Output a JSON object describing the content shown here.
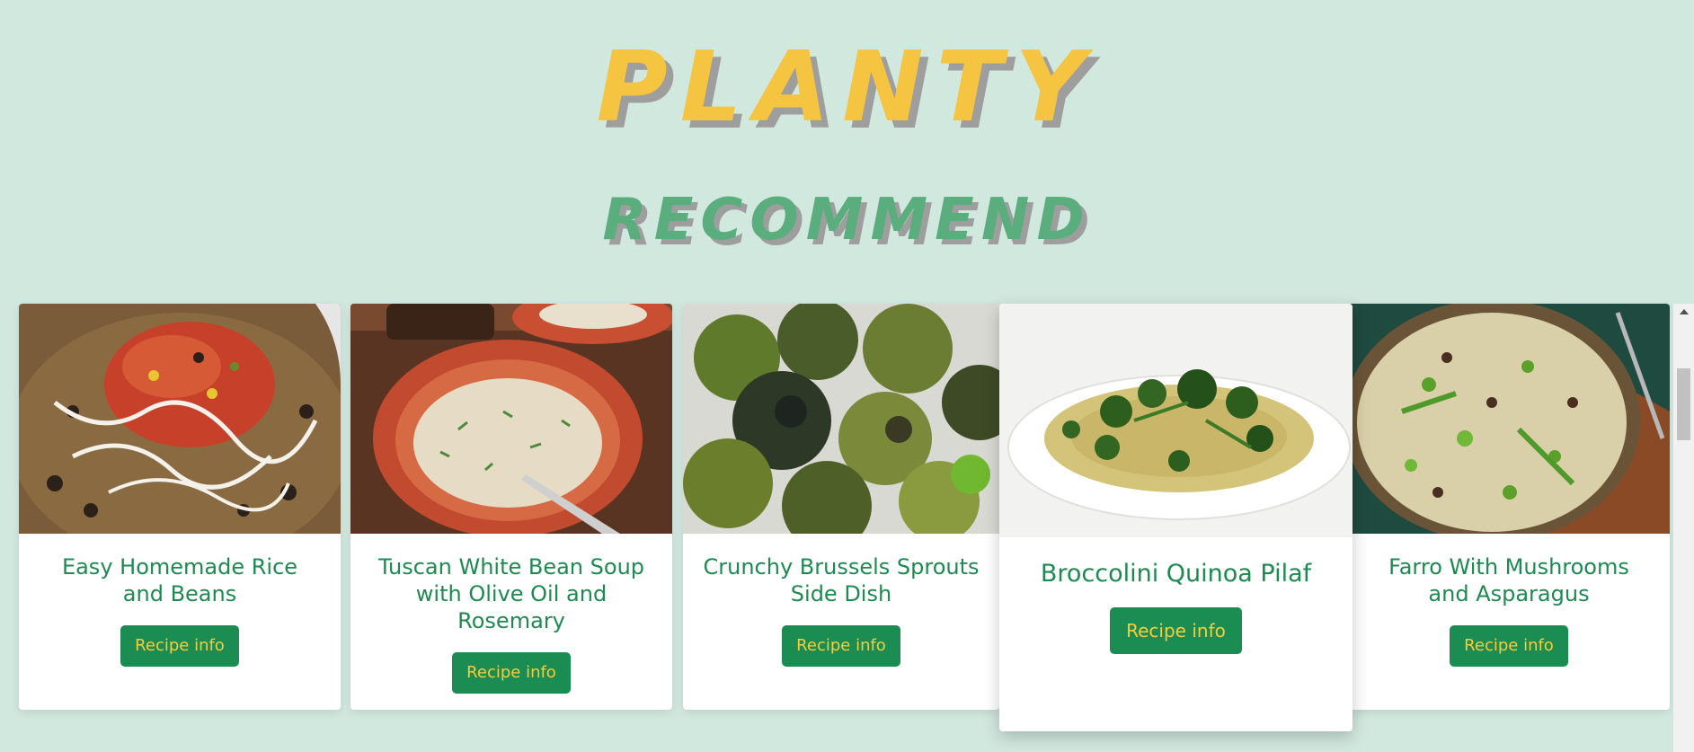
{
  "header": {
    "title": "PLANTY",
    "subtitle": "RECOMMEND"
  },
  "colors": {
    "background": "#d1e8df",
    "title": "#f5c542",
    "subtitle": "#5aae7d",
    "card_title": "#1e8a52",
    "button_bg": "#1b8c52",
    "button_text": "#f6cd3a"
  },
  "recipes": [
    {
      "title": "Easy Homemade Rice and Beans",
      "button_label": "Recipe info",
      "image": "rice-and-beans-photo"
    },
    {
      "title": "Tuscan White Bean Soup with Olive Oil and Rosemary",
      "button_label": "Recipe info",
      "image": "white-bean-soup-photo"
    },
    {
      "title": "Crunchy Brussels Sprouts Side Dish",
      "button_label": "Recipe info",
      "image": "brussels-sprouts-photo"
    },
    {
      "title": "Broccolini Quinoa Pilaf",
      "button_label": "Recipe info",
      "image": "quinoa-pilaf-photo"
    },
    {
      "title": "Farro With Mushrooms and Asparagus",
      "button_label": "Recipe info",
      "image": "farro-bowl-photo"
    }
  ]
}
